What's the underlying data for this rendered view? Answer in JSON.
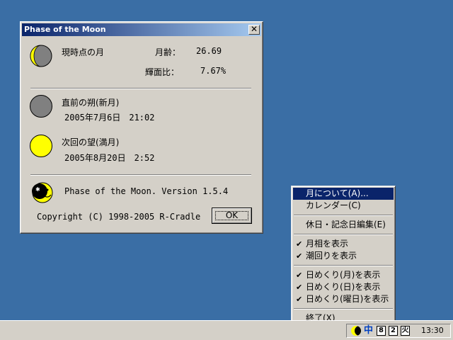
{
  "dialog": {
    "title": "Phase of the Moon",
    "close_glyph": "✕",
    "current": {
      "label": "現時点の月",
      "age_label": "月齢：",
      "age_value": "26.69",
      "illum_label": "輝面比：",
      "illum_value": "7.67%"
    },
    "previous": {
      "label": "直前の朔(新月)",
      "date": "2005年7月6日　21:02",
      "color": "#808080"
    },
    "next": {
      "label": "次回の望(満月)",
      "date": "2005年8月20日　2:52",
      "color": "#ffff00"
    },
    "version": "Phase of the Moon. Version 1.5.4",
    "copyright": "Copyright (C) 1998-2005 R-Cradle",
    "ok_label": "OK"
  },
  "menu": {
    "items": [
      {
        "label": "月について(A)...",
        "checked": false,
        "selected": true
      },
      {
        "label": "カレンダー(C)",
        "checked": false
      },
      {
        "separator": true
      },
      {
        "label": "休日・記念日編集(E)",
        "checked": false
      },
      {
        "separator": true
      },
      {
        "label": "月相を表示",
        "checked": true
      },
      {
        "label": "潮回りを表示",
        "checked": true
      },
      {
        "separator": true
      },
      {
        "label": "日めくり(月)を表示",
        "checked": true
      },
      {
        "label": "日めくり(日)を表示",
        "checked": true
      },
      {
        "label": "日めくり(曜日)を表示",
        "checked": true
      },
      {
        "separator": true
      },
      {
        "label": "終了(X)",
        "checked": false
      }
    ],
    "check_glyph": "✔"
  },
  "taskbar": {
    "ime": "中",
    "month": "8",
    "day": "2",
    "weekday": "火",
    "clock": "13:30"
  },
  "colors": {
    "desktop": "#3a6ea5",
    "title_start": "#0a246a",
    "title_end": "#a6caf0",
    "selection": "#0a246a",
    "face": "#d4d0c8"
  }
}
